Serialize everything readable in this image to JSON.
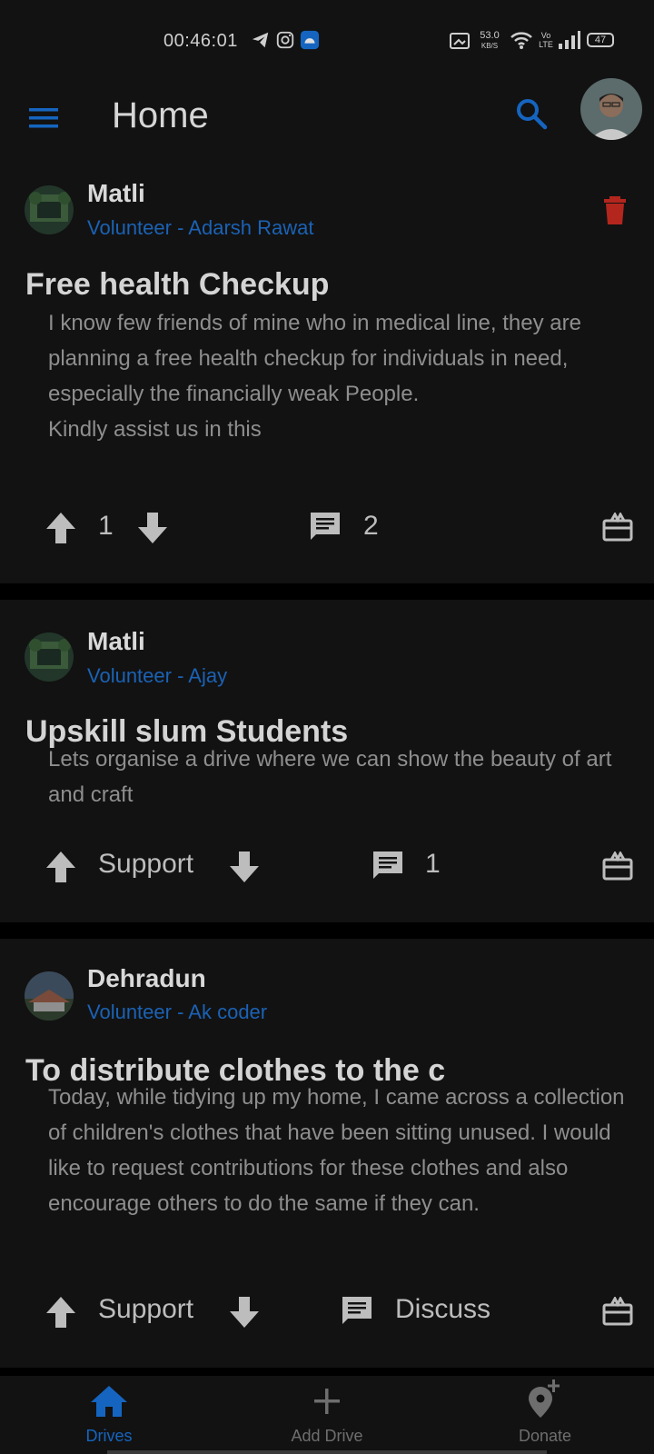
{
  "status": {
    "time": "00:46:01",
    "net_speed_value": "53.0",
    "net_speed_unit": "KB/S",
    "volte": "Vo LTE",
    "battery": "47"
  },
  "appbar": {
    "title": "Home",
    "menu_icon": "menu-icon",
    "search_icon": "search-icon"
  },
  "colors": {
    "accent": "#1565c0",
    "delete": "#c62828",
    "card_bg": "#121212",
    "page_bg": "#000000"
  },
  "posts": [
    {
      "location": "Matli",
      "volunteer": "Volunteer - Adarsh Rawat",
      "title": "Free health Checkup",
      "body": [
        "I know few friends of mine who in medical line, they are planning a free health checkup for individuals in need, especially the financially weak People.",
        "Kindly assist us in this"
      ],
      "votes": "1",
      "comments": "2"
    },
    {
      "location": "Matli",
      "volunteer": "Volunteer - Ajay",
      "title": "Upskill slum Students",
      "body": [
        "Lets organise a drive where we can show the beauty of art and craft"
      ],
      "votes": "Support",
      "comments": "1"
    },
    {
      "location": "Dehradun",
      "volunteer": "Volunteer - Ak coder",
      "title": "To distribute clothes to the c",
      "body": [
        "Today, while tidying up my home, I came across a collection of children's clothes that have been sitting unused. I would like to request contributions for these clothes and also encourage others to do the same if they can."
      ],
      "votes": "Support",
      "comments": "Discuss"
    }
  ],
  "nav": [
    {
      "label": "Drives",
      "icon": "home-icon",
      "active": true
    },
    {
      "label": "Add Drive",
      "icon": "plus-icon",
      "active": false
    },
    {
      "label": "Donate",
      "icon": "add-location-icon",
      "active": false
    }
  ]
}
